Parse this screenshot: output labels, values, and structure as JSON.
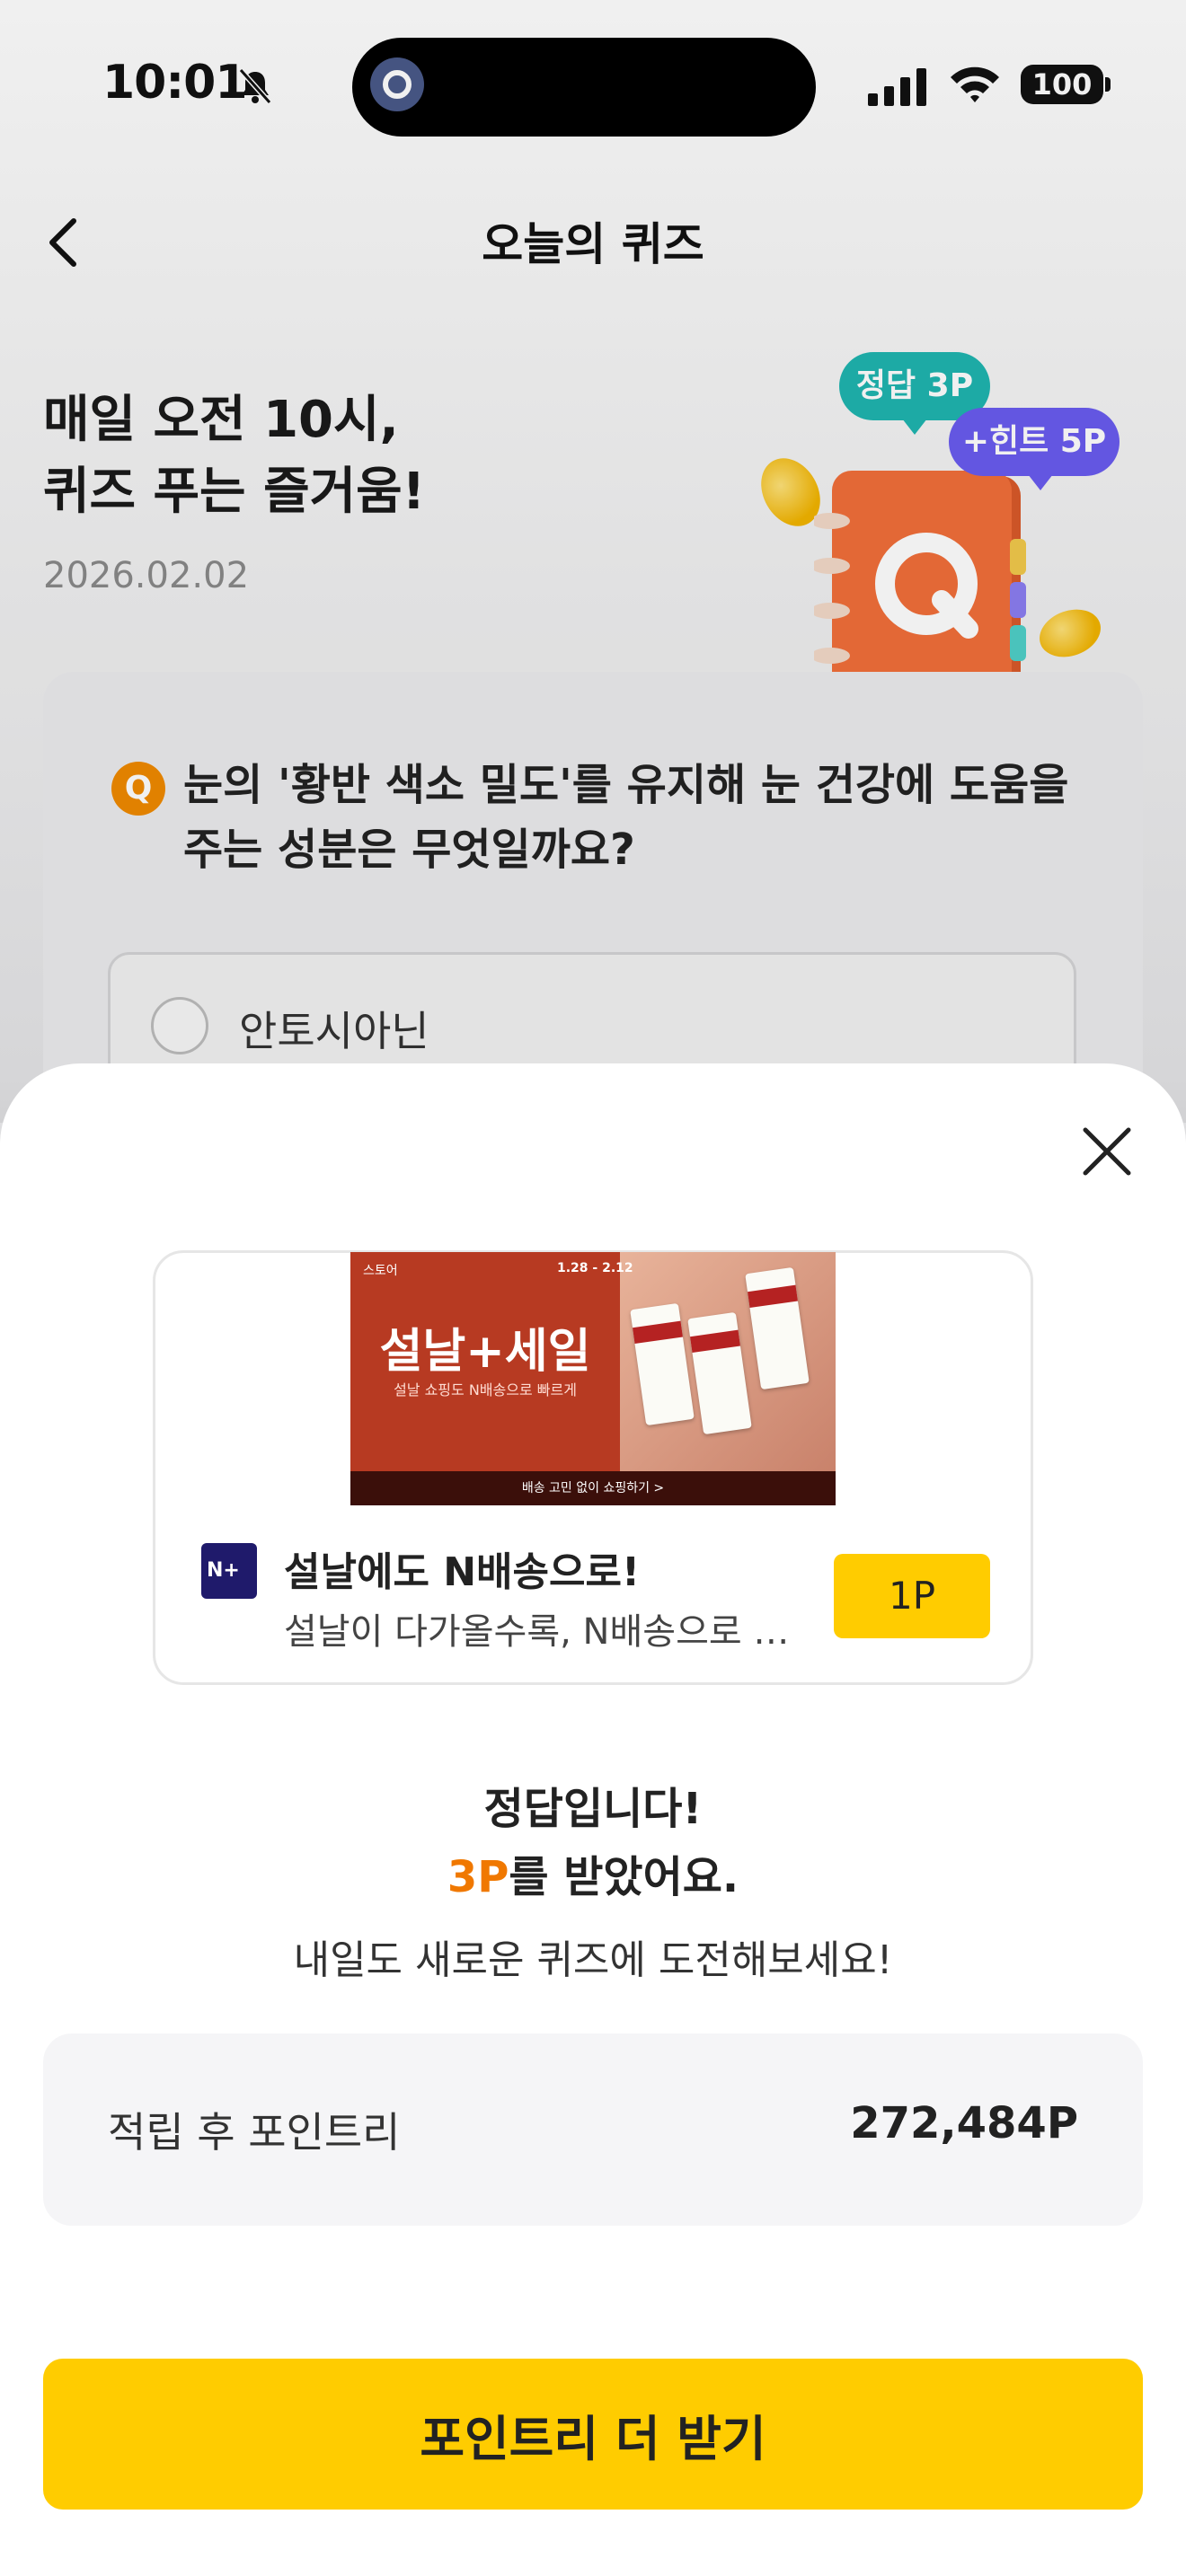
{
  "status_bar": {
    "time": "10:01",
    "battery": "100"
  },
  "header": {
    "title": "오늘의 퀴즈"
  },
  "hero": {
    "line1": "매일 오전 10시,",
    "line2": "퀴즈 푸는 즐거움!",
    "date": "2026.02.02",
    "bubble_correct": "정답 3P",
    "bubble_hint": "+힌트 5P",
    "notebook_letter": "Q"
  },
  "quiz": {
    "badge": "Q",
    "question": "눈의 '황반 색소 밀도'를 유지해 눈 건강에 도움을 주는 성분은 무엇일까요?",
    "option_1": "안토시아닌"
  },
  "ad": {
    "banner_store": "스토어",
    "banner_dates": "1.28 - 2.12",
    "banner_title": "설날+세일",
    "banner_subtitle": "설날 쇼핑도 N배송으로 빠르게",
    "banner_footer": "배송 고민 없이 쇼핑하기 >",
    "title": "설날에도 N배송으로!",
    "description": "설날이 다가올수록, N배송으로 선...",
    "point": "1P"
  },
  "result": {
    "line1": "정답입니다!",
    "points": "3P",
    "line2_suffix": "를 받았어요.",
    "line3": "내일도 새로운 퀴즈에 도전해보세요!"
  },
  "balance": {
    "label": "적립 후 포인트리",
    "value": "272,484P"
  },
  "cta": {
    "label": "포인트리 더 받기"
  },
  "colors": {
    "accent": "#ffcc00",
    "points": "#f07800",
    "quiz_badge": "#f08a00",
    "bubble_correct": "#1fb5b0",
    "bubble_hint": "#6a5cf0"
  }
}
